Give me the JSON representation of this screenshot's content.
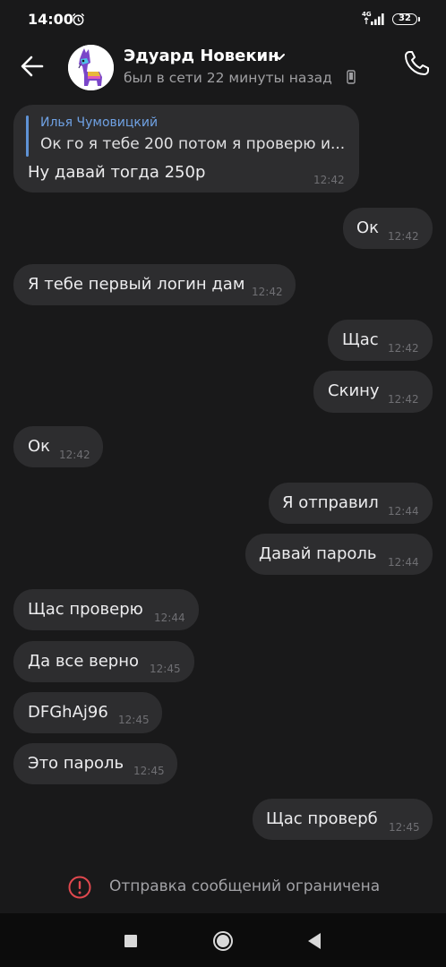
{
  "status_bar": {
    "time": "14:00",
    "network": "4G",
    "battery": "32"
  },
  "header": {
    "contact_name": "Эдуард Новекин",
    "last_seen": "был в сети 22 минуты назад"
  },
  "messages": [
    {
      "direction": "incoming",
      "reply": {
        "author": "Илья Чумовицкий",
        "text": "Ок го я тебе 200 потом я проверю и..."
      },
      "text": "Ну давай тогда 250р",
      "time": "12:42"
    },
    {
      "direction": "outgoing",
      "text": "Ок",
      "time": "12:42"
    },
    {
      "direction": "incoming",
      "text": "Я тебе первый логин дам",
      "time": "12:42"
    },
    {
      "direction": "outgoing",
      "text": "Щас",
      "time": "12:42"
    },
    {
      "direction": "outgoing",
      "text": "Скину",
      "time": "12:42"
    },
    {
      "direction": "incoming",
      "text": "Ок",
      "time": "12:42"
    },
    {
      "direction": "outgoing",
      "text": "Я отправил",
      "time": "12:44"
    },
    {
      "direction": "outgoing",
      "text": "Давай пароль",
      "time": "12:44"
    },
    {
      "direction": "incoming",
      "text": "Щас проверю",
      "time": "12:44"
    },
    {
      "direction": "incoming",
      "text": "Да все верно",
      "time": "12:45"
    },
    {
      "direction": "incoming",
      "text": "DFGhAj96",
      "time": "12:45"
    },
    {
      "direction": "incoming",
      "text": "Это пароль",
      "time": "12:45"
    },
    {
      "direction": "outgoing",
      "text": "Щас проверб",
      "time": "12:45"
    }
  ],
  "notice": {
    "text": "Отправка сообщений ограничена",
    "icon": "warning-icon"
  },
  "colors": {
    "background": "#19191a",
    "bubble": "#2d2d2f",
    "reply_accent": "#5f93d6",
    "warning": "#e0484e"
  }
}
